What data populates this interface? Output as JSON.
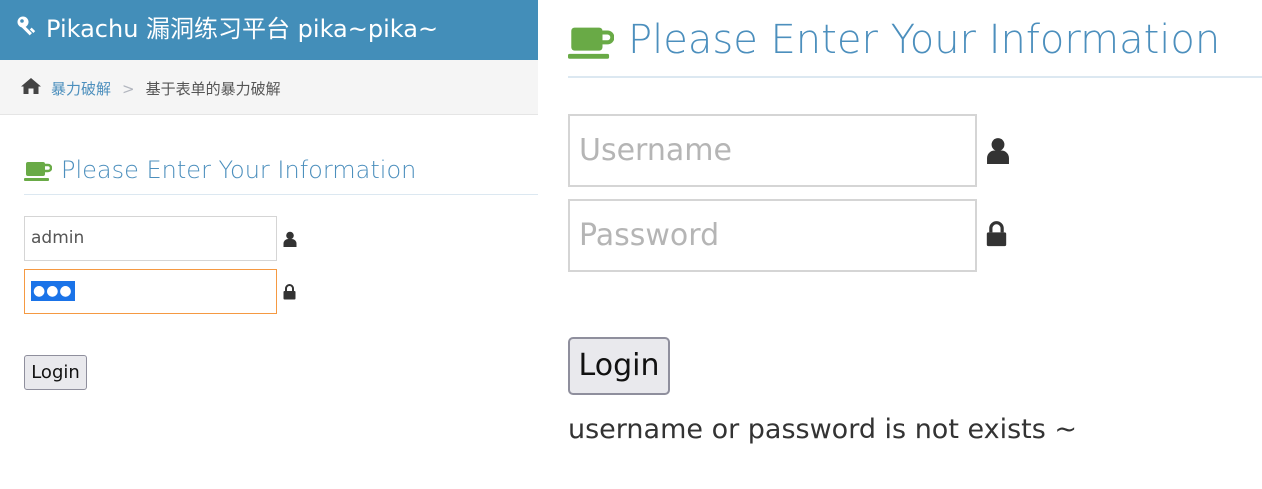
{
  "left_panel": {
    "brand": {
      "title": "Pikachu 漏洞练习平台 pika~pika~",
      "icon": "key-icon"
    },
    "breadcrumb": {
      "home_icon": "home-icon",
      "link": "暴力破解",
      "separator": ">",
      "current": "基于表单的暴力破解"
    },
    "form": {
      "heading": "Please Enter Your Information",
      "heading_icon": "coffee-cup-icon",
      "username_value": "admin",
      "password_value": "●●●",
      "user_icon": "user-icon",
      "lock_icon": "lock-icon",
      "login_label": "Login"
    }
  },
  "right_panel": {
    "form": {
      "heading": "Please Enter Your Information",
      "heading_icon": "coffee-cup-icon",
      "username_placeholder": "Username",
      "password_placeholder": "Password",
      "user_icon": "user-icon",
      "lock_icon": "lock-icon",
      "login_label": "Login",
      "error_message": "username or password is not exists ~"
    }
  },
  "colors": {
    "topbar": "#438eb9",
    "accent": "#4c8fbd",
    "cup": "#69aa46",
    "focus_border": "#f59942",
    "selection": "#1a73e8"
  }
}
